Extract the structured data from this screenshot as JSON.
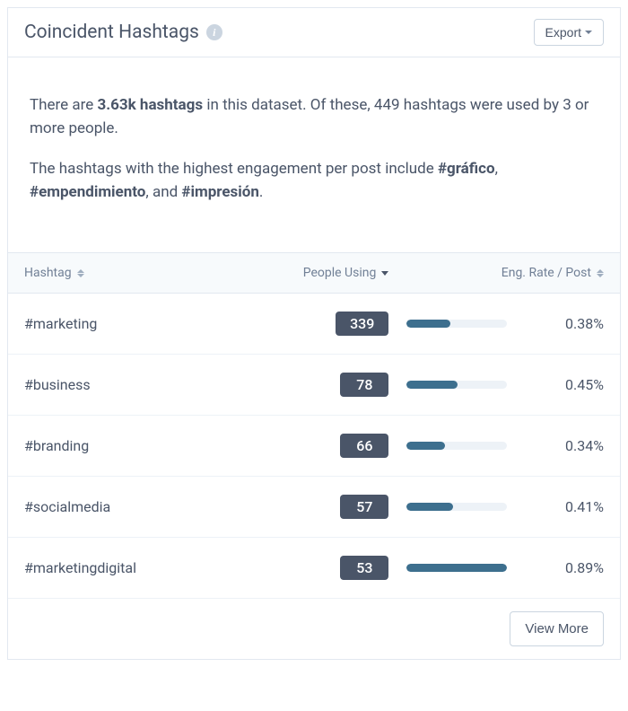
{
  "header": {
    "title": "Coincident Hashtags",
    "export_label": "Export"
  },
  "summary": {
    "line1_prefix": "There are ",
    "total_hashtags": "3.63k hashtags",
    "line1_mid": " in this dataset. Of these, ",
    "filtered_count": "449",
    "line1_suffix": " hashtags were used by 3 or more people.",
    "line2_prefix": "The hashtags with the highest engagement per post include ",
    "top1": "#gráfico",
    "sep1": ", ",
    "top2": "#empendimiento",
    "sep2": ", and ",
    "top3": "#impresión",
    "line2_suffix": "."
  },
  "table": {
    "headers": {
      "hashtag": "Hashtag",
      "people_using": "People Using",
      "eng_rate": "Eng. Rate / Post"
    },
    "rows": [
      {
        "hashtag": "#marketing",
        "people": "339",
        "eng_rate": "0.38%",
        "bar_pct": 43
      },
      {
        "hashtag": "#business",
        "people": "78",
        "eng_rate": "0.45%",
        "bar_pct": 51
      },
      {
        "hashtag": "#branding",
        "people": "66",
        "eng_rate": "0.34%",
        "bar_pct": 38
      },
      {
        "hashtag": "#socialmedia",
        "people": "57",
        "eng_rate": "0.41%",
        "bar_pct": 46
      },
      {
        "hashtag": "#marketingdigital",
        "people": "53",
        "eng_rate": "0.89%",
        "bar_pct": 100
      }
    ]
  },
  "footer": {
    "view_more_label": "View More"
  }
}
